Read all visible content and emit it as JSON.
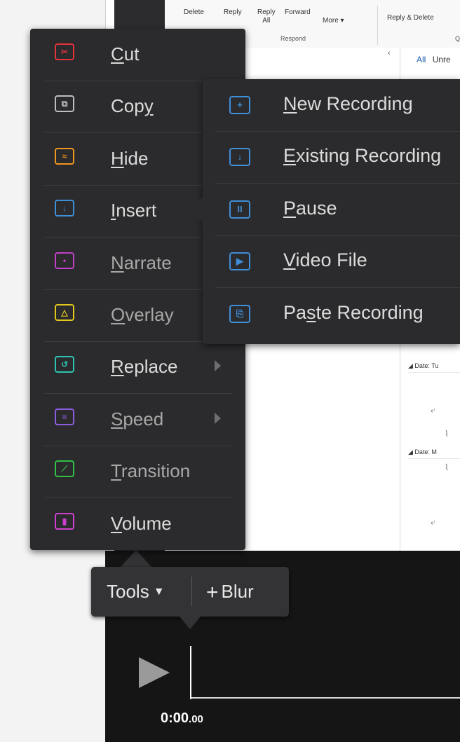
{
  "ribbon": {
    "delete": "Delete",
    "reply": "Reply",
    "reply_all_1": "Reply",
    "reply_all_2": "All",
    "forward": "Forward",
    "more": "More ▾",
    "reply_delete": "Reply & Delete",
    "respond_group": "Respond",
    "quick_group": "Q"
  },
  "inbox": {
    "tab_all": "All",
    "tab_unread": "Unre",
    "collapse": "‹",
    "date1": "◢  Date: Tu",
    "date2": "◢  Date: M"
  },
  "menu": {
    "items": [
      {
        "pre": "",
        "ul": "C",
        "post": "ut",
        "icon": "scissors-icon",
        "color": "#e0343a",
        "glyph": "✂"
      },
      {
        "pre": "Cop",
        "ul": "y",
        "post": "",
        "icon": "copy-icon",
        "color": "#bdbdbd",
        "glyph": "⧉"
      },
      {
        "pre": "",
        "ul": "H",
        "post": "ide",
        "icon": "hide-eye-icon",
        "color": "#f0961e",
        "glyph": "≈"
      },
      {
        "pre": "",
        "ul": "I",
        "post": "nsert",
        "icon": "insert-icon",
        "color": "#3f8ed8",
        "glyph": "↓"
      },
      {
        "pre": "",
        "ul": "N",
        "post": "arrate",
        "icon": "narrate-icon",
        "color": "#c23fc7",
        "glyph": "•"
      },
      {
        "pre": "",
        "ul": "O",
        "post": "verlay",
        "icon": "overlay-triangle-icon",
        "color": "#e3c81c",
        "glyph": "△"
      },
      {
        "pre": "",
        "ul": "R",
        "post": "eplace",
        "icon": "replace-icon",
        "color": "#2ec4b0",
        "glyph": "↺"
      },
      {
        "pre": "",
        "ul": "S",
        "post": "peed",
        "icon": "speed-icon",
        "color": "#8b5ce0",
        "glyph": "≡"
      },
      {
        "pre": "",
        "ul": "T",
        "post": "ransition",
        "icon": "transition-icon",
        "color": "#2fc246",
        "glyph": "⟋"
      },
      {
        "pre": "",
        "ul": "V",
        "post": "olume",
        "icon": "volume-bars-icon",
        "color": "#cf3fcf",
        "glyph": "▮"
      }
    ]
  },
  "submenu": {
    "items": [
      {
        "pre": "",
        "ul": "N",
        "post": "ew Recording",
        "icon": "new-recording-icon",
        "glyph": "+"
      },
      {
        "pre": "",
        "ul": "E",
        "post": "xisting Recording",
        "icon": "existing-recording-icon",
        "glyph": "↓"
      },
      {
        "pre": "",
        "ul": "P",
        "post": "ause",
        "icon": "pause-icon",
        "glyph": "II"
      },
      {
        "pre": "",
        "ul": "V",
        "post": "ideo File",
        "icon": "video-file-icon",
        "glyph": "▶"
      },
      {
        "pre": "Pa",
        "ul": "s",
        "post": "te Recording",
        "icon": "paste-recording-icon",
        "glyph": "⎘"
      }
    ]
  },
  "tools": {
    "tools_label": "Tools",
    "caret": "▼",
    "plus": "+",
    "blur_label": "Blur"
  },
  "player": {
    "time_main": "0:00",
    "time_ms": ".00"
  }
}
